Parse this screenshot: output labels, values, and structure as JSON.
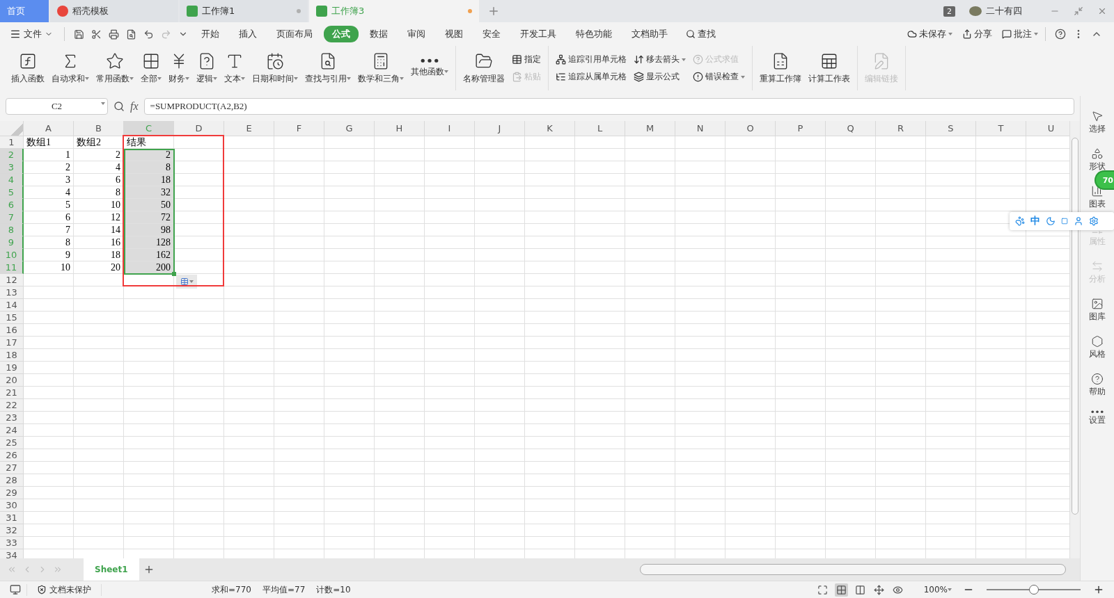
{
  "app_tabs": [
    {
      "label": "首页",
      "kind": "home",
      "selected": false
    },
    {
      "label": "稻壳模板",
      "kind": "template",
      "selected": false
    },
    {
      "label": "工作簿1",
      "kind": "sheet",
      "selected": false,
      "color": "#b0b0b0"
    },
    {
      "label": "工作簿3",
      "kind": "sheet",
      "selected": true,
      "color": "#f0a050"
    }
  ],
  "title_right": {
    "window_count": "2",
    "user": "二十有四"
  },
  "menu": {
    "file": "文件",
    "tabs": [
      {
        "label": "开始",
        "selected": false
      },
      {
        "label": "插入",
        "selected": false
      },
      {
        "label": "页面布局",
        "selected": false
      },
      {
        "label": "公式",
        "selected": true
      },
      {
        "label": "数据",
        "selected": false
      },
      {
        "label": "审阅",
        "selected": false
      },
      {
        "label": "视图",
        "selected": false
      },
      {
        "label": "安全",
        "selected": false
      },
      {
        "label": "开发工具",
        "selected": false
      },
      {
        "label": "特色功能",
        "selected": false
      },
      {
        "label": "文档助手",
        "selected": false
      }
    ],
    "search": "查找",
    "right": [
      {
        "label": "未保存",
        "dropdown": true
      },
      {
        "label": "分享",
        "dropdown": false
      },
      {
        "label": "批注",
        "dropdown": true
      }
    ]
  },
  "ribbon": [
    {
      "items": [
        {
          "kind": "large",
          "label": "插入函数",
          "dropdown": false,
          "disabled": false
        },
        {
          "kind": "large",
          "label": "自动求和",
          "dropdown": true,
          "disabled": false
        },
        {
          "kind": "large",
          "label": "常用函数",
          "dropdown": true,
          "disabled": false
        },
        {
          "kind": "large",
          "label": "全部",
          "dropdown": true,
          "disabled": false
        },
        {
          "kind": "large",
          "label": "财务",
          "dropdown": true,
          "disabled": false
        },
        {
          "kind": "large",
          "label": "逻辑",
          "dropdown": true,
          "disabled": false
        },
        {
          "kind": "large",
          "label": "文本",
          "dropdown": true,
          "disabled": false
        },
        {
          "kind": "large",
          "label": "日期和时间",
          "dropdown": true,
          "disabled": false
        },
        {
          "kind": "large",
          "label": "查找与引用",
          "dropdown": true,
          "disabled": false
        },
        {
          "kind": "large",
          "label": "数学和三角",
          "dropdown": true,
          "disabled": false
        },
        {
          "kind": "large",
          "label": "其他函数",
          "dropdown": true,
          "disabled": false
        }
      ]
    },
    {
      "items": [
        {
          "kind": "large",
          "label": "名称管理器",
          "dropdown": false,
          "disabled": false
        },
        {
          "kind": "stack",
          "buttons": [
            {
              "label": "指定",
              "dropdown": false,
              "disabled": false
            },
            {
              "label": "粘贴",
              "dropdown": false,
              "disabled": true
            }
          ]
        }
      ]
    },
    {
      "items": [
        {
          "kind": "stack",
          "buttons": [
            {
              "label": "追踪引用单元格",
              "dropdown": false,
              "disabled": false
            },
            {
              "label": "追踪从属单元格",
              "dropdown": false,
              "disabled": false
            }
          ]
        },
        {
          "kind": "stack",
          "buttons": [
            {
              "label": "移去箭头",
              "dropdown": true,
              "disabled": false
            },
            {
              "label": "显示公式",
              "dropdown": false,
              "disabled": false
            }
          ]
        },
        {
          "kind": "stack",
          "buttons": [
            {
              "label": "公式求值",
              "dropdown": false,
              "disabled": true
            },
            {
              "label": "错误检查",
              "dropdown": true,
              "disabled": false
            }
          ]
        }
      ]
    },
    {
      "items": [
        {
          "kind": "large",
          "label": "重算工作簿",
          "dropdown": false,
          "disabled": false
        },
        {
          "kind": "large",
          "label": "计算工作表",
          "dropdown": false,
          "disabled": false
        }
      ]
    },
    {
      "items": [
        {
          "kind": "large",
          "label": "编辑链接",
          "dropdown": false,
          "disabled": true
        }
      ]
    }
  ],
  "formula_bar": {
    "name_box": "C2",
    "fx": "fx",
    "formula": "=SUMPRODUCT(A2,B2)"
  },
  "columns": [
    {
      "label": "A",
      "selected": false
    },
    {
      "label": "B",
      "selected": false
    },
    {
      "label": "C",
      "selected": true
    },
    {
      "label": "D",
      "selected": false
    },
    {
      "label": "E",
      "selected": false
    },
    {
      "label": "F",
      "selected": false
    },
    {
      "label": "G",
      "selected": false
    },
    {
      "label": "H",
      "selected": false
    },
    {
      "label": "I",
      "selected": false
    },
    {
      "label": "J",
      "selected": false
    },
    {
      "label": "K",
      "selected": false
    },
    {
      "label": "L",
      "selected": false
    },
    {
      "label": "M",
      "selected": false
    },
    {
      "label": "N",
      "selected": false
    },
    {
      "label": "O",
      "selected": false
    },
    {
      "label": "P",
      "selected": false
    },
    {
      "label": "Q",
      "selected": false
    },
    {
      "label": "R",
      "selected": false
    },
    {
      "label": "S",
      "selected": false
    },
    {
      "label": "T",
      "selected": false
    },
    {
      "label": "U",
      "selected": false
    }
  ],
  "rows": [
    {
      "number": "1",
      "selected": false,
      "cells": [
        {
          "value": "数组1",
          "kind": "text",
          "selected": false
        },
        {
          "value": "数组2",
          "kind": "text",
          "selected": false
        },
        {
          "value": "结果",
          "kind": "text",
          "selected": false
        }
      ]
    },
    {
      "number": "2",
      "selected": true,
      "cells": [
        {
          "value": "1",
          "kind": "number",
          "selected": false
        },
        {
          "value": "2",
          "kind": "number",
          "selected": false
        },
        {
          "value": "2",
          "kind": "number",
          "selected": true
        }
      ]
    },
    {
      "number": "3",
      "selected": true,
      "cells": [
        {
          "value": "2",
          "kind": "number",
          "selected": false
        },
        {
          "value": "4",
          "kind": "number",
          "selected": false
        },
        {
          "value": "8",
          "kind": "number",
          "selected": true
        }
      ]
    },
    {
      "number": "4",
      "selected": true,
      "cells": [
        {
          "value": "3",
          "kind": "number",
          "selected": false
        },
        {
          "value": "6",
          "kind": "number",
          "selected": false
        },
        {
          "value": "18",
          "kind": "number",
          "selected": true
        }
      ]
    },
    {
      "number": "5",
      "selected": true,
      "cells": [
        {
          "value": "4",
          "kind": "number",
          "selected": false
        },
        {
          "value": "8",
          "kind": "number",
          "selected": false
        },
        {
          "value": "32",
          "kind": "number",
          "selected": true
        }
      ]
    },
    {
      "number": "6",
      "selected": true,
      "cells": [
        {
          "value": "5",
          "kind": "number",
          "selected": false
        },
        {
          "value": "10",
          "kind": "number",
          "selected": false
        },
        {
          "value": "50",
          "kind": "number",
          "selected": true
        }
      ]
    },
    {
      "number": "7",
      "selected": true,
      "cells": [
        {
          "value": "6",
          "kind": "number",
          "selected": false
        },
        {
          "value": "12",
          "kind": "number",
          "selected": false
        },
        {
          "value": "72",
          "kind": "number",
          "selected": true
        }
      ]
    },
    {
      "number": "8",
      "selected": true,
      "cells": [
        {
          "value": "7",
          "kind": "number",
          "selected": false
        },
        {
          "value": "14",
          "kind": "number",
          "selected": false
        },
        {
          "value": "98",
          "kind": "number",
          "selected": true
        }
      ]
    },
    {
      "number": "9",
      "selected": true,
      "cells": [
        {
          "value": "8",
          "kind": "number",
          "selected": false
        },
        {
          "value": "16",
          "kind": "number",
          "selected": false
        },
        {
          "value": "128",
          "kind": "number",
          "selected": true
        }
      ]
    },
    {
      "number": "10",
      "selected": true,
      "cells": [
        {
          "value": "9",
          "kind": "number",
          "selected": false
        },
        {
          "value": "18",
          "kind": "number",
          "selected": false
        },
        {
          "value": "162",
          "kind": "number",
          "selected": true
        }
      ]
    },
    {
      "number": "11",
      "selected": true,
      "cells": [
        {
          "value": "10",
          "kind": "number",
          "selected": false
        },
        {
          "value": "20",
          "kind": "number",
          "selected": false
        },
        {
          "value": "200",
          "kind": "number",
          "selected": true
        }
      ]
    },
    {
      "number": "12",
      "selected": false
    },
    {
      "number": "13",
      "selected": false
    },
    {
      "number": "14",
      "selected": false
    },
    {
      "number": "15",
      "selected": false
    },
    {
      "number": "16",
      "selected": false
    },
    {
      "number": "17",
      "selected": false
    },
    {
      "number": "18",
      "selected": false
    },
    {
      "number": "19",
      "selected": false
    },
    {
      "number": "20",
      "selected": false
    },
    {
      "number": "21",
      "selected": false
    },
    {
      "number": "22",
      "selected": false
    },
    {
      "number": "23",
      "selected": false
    },
    {
      "number": "24",
      "selected": false
    },
    {
      "number": "25",
      "selected": false
    },
    {
      "number": "26",
      "selected": false
    },
    {
      "number": "27",
      "selected": false
    },
    {
      "number": "28",
      "selected": false
    },
    {
      "number": "29",
      "selected": false
    },
    {
      "number": "30",
      "selected": false
    },
    {
      "number": "31",
      "selected": false
    },
    {
      "number": "32",
      "selected": false
    },
    {
      "number": "33",
      "selected": false
    },
    {
      "number": "34",
      "selected": false
    }
  ],
  "annotation": {
    "kind": "rectangle"
  },
  "sheet_tabs": [
    {
      "label": "Sheet1",
      "selected": true
    }
  ],
  "sidebar": [
    {
      "label": "选择",
      "disabled": false
    },
    {
      "label": "形状",
      "disabled": false
    },
    {
      "label": "图表",
      "disabled": false
    },
    {
      "label": "属性",
      "disabled": true
    },
    {
      "label": "分析",
      "disabled": true
    },
    {
      "label": "图库",
      "disabled": false
    },
    {
      "label": "风格",
      "disabled": false
    },
    {
      "label": "帮助",
      "disabled": false
    },
    {
      "label": "设置",
      "disabled": false
    }
  ],
  "ime_bar": {
    "mode": "中"
  },
  "score_badge": "70",
  "status_bar": {
    "protection": "文档未保护",
    "stats": [
      "求和=770",
      "平均值=77",
      "计数=10"
    ],
    "zoom": "100%",
    "zoom_slider": {
      "level": 0.5
    }
  }
}
